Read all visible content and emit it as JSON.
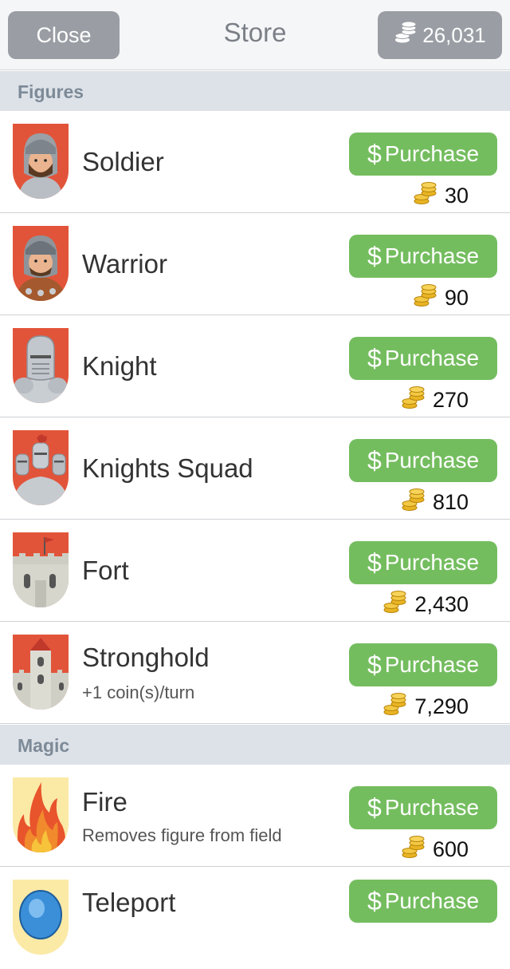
{
  "navbar": {
    "close_label": "Close",
    "title": "Store",
    "coins": "26,031"
  },
  "sections": {
    "figures": "Figures",
    "magic": "Magic"
  },
  "purchase_label": "Purchase",
  "items": [
    {
      "name": "Soldier",
      "desc": "",
      "price": "30",
      "icon": "soldier-icon"
    },
    {
      "name": "Warrior",
      "desc": "",
      "price": "90",
      "icon": "warrior-icon"
    },
    {
      "name": "Knight",
      "desc": "",
      "price": "270",
      "icon": "knight-icon"
    },
    {
      "name": "Knights Squad",
      "desc": "",
      "price": "810",
      "icon": "knights-squad-icon"
    },
    {
      "name": "Fort",
      "desc": "",
      "price": "2,430",
      "icon": "fort-icon"
    },
    {
      "name": "Stronghold",
      "desc": "+1 coin(s)/turn",
      "price": "7,290",
      "icon": "stronghold-icon"
    },
    {
      "name": "Fire",
      "desc": "Removes figure from field",
      "price": "600",
      "icon": "fire-icon"
    },
    {
      "name": "Teleport",
      "desc": "",
      "price": "",
      "icon": "teleport-icon"
    }
  ],
  "colors": {
    "accent_green": "#74bd5f",
    "nav_button_gray": "#9a9ea4",
    "figure_bg_red": "#e2543a",
    "magic_bg_yellow": "#fbe9a6"
  }
}
